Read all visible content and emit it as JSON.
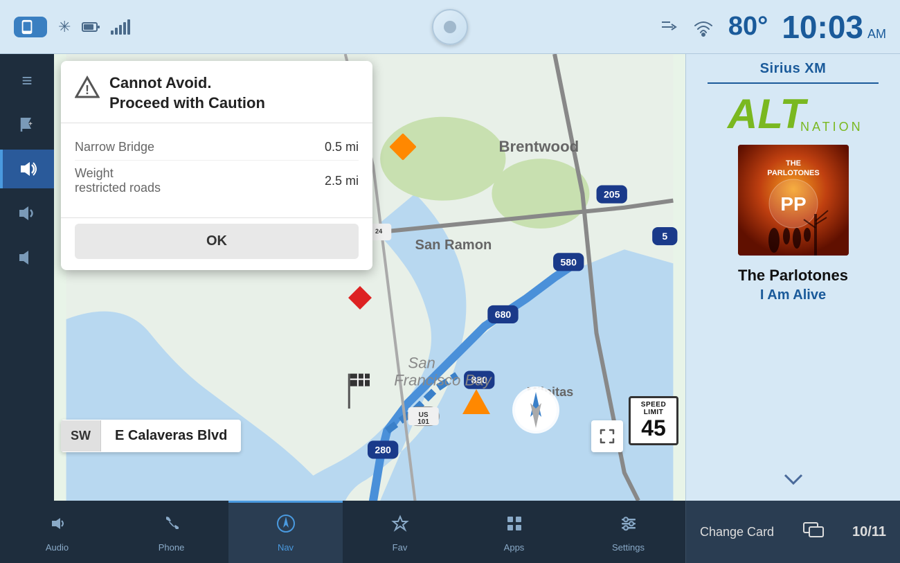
{
  "statusBar": {
    "temperature": "80°",
    "time": "10:03",
    "ampm": "AM"
  },
  "caution": {
    "title": "Cannot Avoid.\nProceed with Caution",
    "rows": [
      {
        "label": "Narrow Bridge",
        "value": "0.5 mi"
      },
      {
        "label": "Weight\nrestricted roads",
        "value": "2.5 mi"
      }
    ],
    "okLabel": "OK"
  },
  "street": {
    "direction": "SW",
    "name": "E Calaveras Blvd"
  },
  "speedLimit": {
    "topText": "SPEED\nLIMIT",
    "number": "45"
  },
  "rightPanel": {
    "source": "Sirius XM",
    "altNationLabel": "ALT NATION",
    "artist": "The Parlotones",
    "song": "I Am Alive",
    "trackCounter": "10/11",
    "changeCardLabel": "Change Card"
  },
  "bottomNav": {
    "items": [
      {
        "id": "audio",
        "label": "Audio",
        "icon": "♪"
      },
      {
        "id": "phone",
        "label": "Phone",
        "icon": "✆"
      },
      {
        "id": "nav",
        "label": "Nav",
        "icon": "⊙",
        "active": true
      },
      {
        "id": "fav",
        "label": "Fav",
        "icon": "☆"
      },
      {
        "id": "apps",
        "label": "Apps",
        "icon": "⊞"
      },
      {
        "id": "settings",
        "label": "Settings",
        "icon": "≡"
      }
    ]
  },
  "sidebar": {
    "items": [
      {
        "id": "menu",
        "icon": "≡"
      },
      {
        "id": "flag",
        "icon": "⚑"
      },
      {
        "id": "volume-active",
        "icon": "🔊",
        "active": true
      },
      {
        "id": "volume-mid",
        "icon": "🔉"
      },
      {
        "id": "volume-low",
        "icon": "🔈"
      }
    ]
  }
}
